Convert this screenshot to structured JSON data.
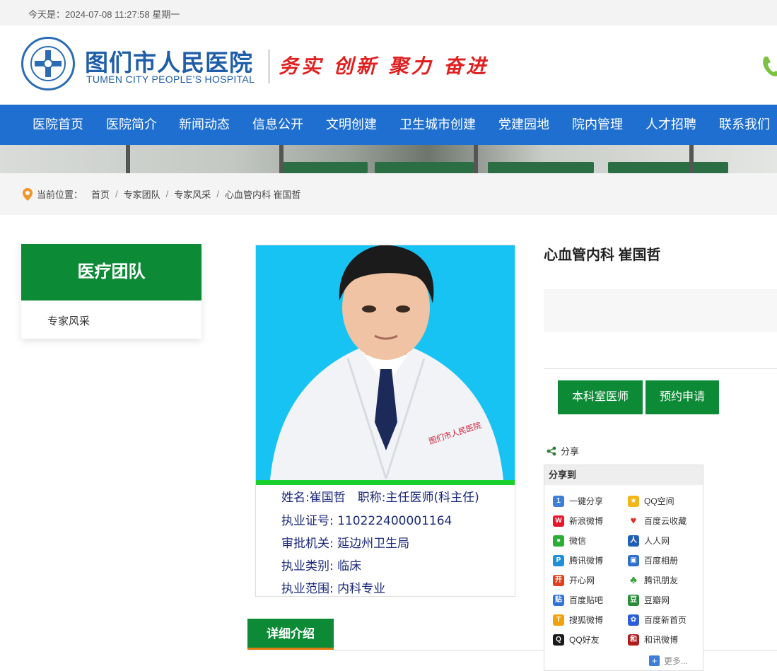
{
  "topbar": {
    "date_text": "今天是：2024-07-08 11:27:58 星期一"
  },
  "header": {
    "logo_cn": "图们市人民医院",
    "logo_en": "TUMEN CITY PEOPLE’S HOSPITAL",
    "slogan": "务实 创新 聚力 奋进"
  },
  "nav": {
    "items": [
      "医院首页",
      "医院简介",
      "新闻动态",
      "信息公开",
      "文明创建",
      "卫生城市创建",
      "党建园地",
      "院内管理",
      "人才招聘",
      "联系我们"
    ]
  },
  "breadcrumb": {
    "label": "当前位置：",
    "items": [
      "首页",
      "专家团队",
      "专家风采",
      "心血管内科 崔国哲"
    ],
    "separator": "/"
  },
  "sidebar": {
    "title": "医疗团队",
    "items": [
      "专家风采"
    ]
  },
  "profile": {
    "photo_lines": [
      "姓名:崔国哲　职称:主任医师(科主任)",
      "执业证号: 110222400001164",
      "审批机关: 延边州卫生局",
      "执业类别: 临床",
      "执业范围: 内科专业"
    ],
    "title": "心血管内科 崔国哲",
    "buttons": [
      "本科室医师",
      "预约申请"
    ],
    "detail_tab": "详细介绍"
  },
  "share": {
    "label": "分享",
    "panel_title": "分享到",
    "items": [
      {
        "label": "一键分享",
        "icon": "one-click-share-icon",
        "color": "#3d7fd8"
      },
      {
        "label": "QQ空间",
        "icon": "qzone-icon",
        "color": "#f2b616"
      },
      {
        "label": "新浪微博",
        "icon": "sina-weibo-icon",
        "color": "#e6162d"
      },
      {
        "label": "百度云收藏",
        "icon": "heart-icon",
        "color": "#e0302a"
      },
      {
        "label": "微信",
        "icon": "wechat-icon",
        "color": "#2aae35"
      },
      {
        "label": "人人网",
        "icon": "renren-icon",
        "color": "#1f5fb5"
      },
      {
        "label": "腾讯微博",
        "icon": "tencent-weibo-icon",
        "color": "#1f8fd6"
      },
      {
        "label": "百度相册",
        "icon": "baidu-album-icon",
        "color": "#2d6fce"
      },
      {
        "label": "开心网",
        "icon": "kaixin-icon",
        "color": "#e2411f"
      },
      {
        "label": "腾讯朋友",
        "icon": "clover-icon",
        "color": "#39a43b"
      },
      {
        "label": "百度贴吧",
        "icon": "tieba-icon",
        "color": "#3373d8"
      },
      {
        "label": "豆瓣网",
        "icon": "douban-icon",
        "color": "#2a8c3a"
      },
      {
        "label": "搜狐微博",
        "icon": "sohu-weibo-icon",
        "color": "#f2a30c"
      },
      {
        "label": "百度新首页",
        "icon": "baidu-paw-icon",
        "color": "#2f5fd8"
      },
      {
        "label": "QQ好友",
        "icon": "qq-penguin-icon",
        "color": "#1a1a1a"
      },
      {
        "label": "和讯微博",
        "icon": "hexun-weibo-icon",
        "color": "#b01c1c"
      }
    ],
    "more": "更多..."
  },
  "colors": {
    "nav_blue": "#1f6fd0",
    "brand_green": "#0d8a36",
    "slogan_red": "#e02020",
    "logo_blue": "#1f5ea8"
  }
}
